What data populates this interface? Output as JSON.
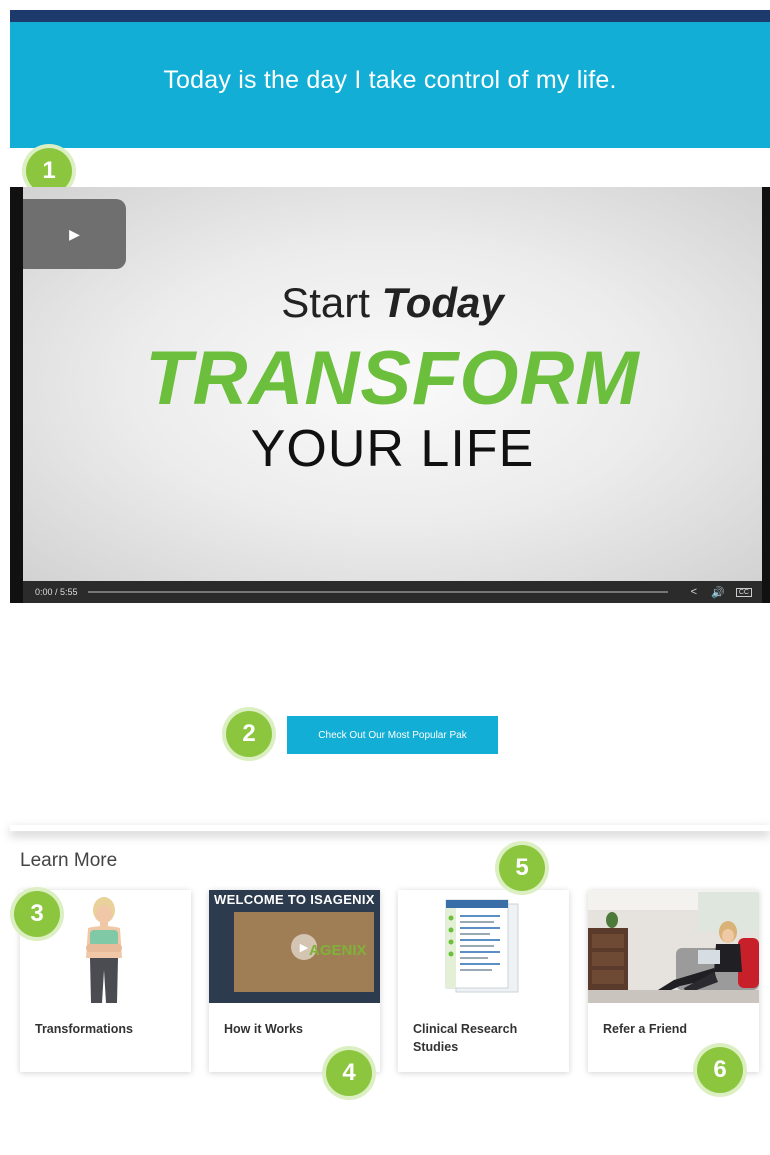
{
  "hero": {
    "title": "Today is the day I take control of my life."
  },
  "badges": [
    "1",
    "2",
    "3",
    "4",
    "5",
    "6"
  ],
  "video": {
    "line1": "Start",
    "line1_bold": "Today",
    "line2": "TRANSFORM",
    "line3": "YOUR LIFE",
    "time": "0:00  /  5:55",
    "cc": "CC",
    "icons": [
      "play-icon",
      "share-icon",
      "volume-icon",
      "captions-icon"
    ]
  },
  "cta": {
    "label": "Check Out Our Most Popular Pak"
  },
  "learn_more": {
    "title": "Learn More",
    "cards": [
      {
        "label": "Transformations"
      },
      {
        "label": "How it Works",
        "banner": "WELCOME TO ISAGENIX",
        "brand": "AGENIX"
      },
      {
        "label": "Clinical Research Studies"
      },
      {
        "label": "Refer a Friend"
      }
    ]
  },
  "colors": {
    "accent": "#13aed5",
    "badge": "#8cc63f",
    "topbar": "#1c3a6b",
    "headline_green": "#6bbf3c"
  }
}
